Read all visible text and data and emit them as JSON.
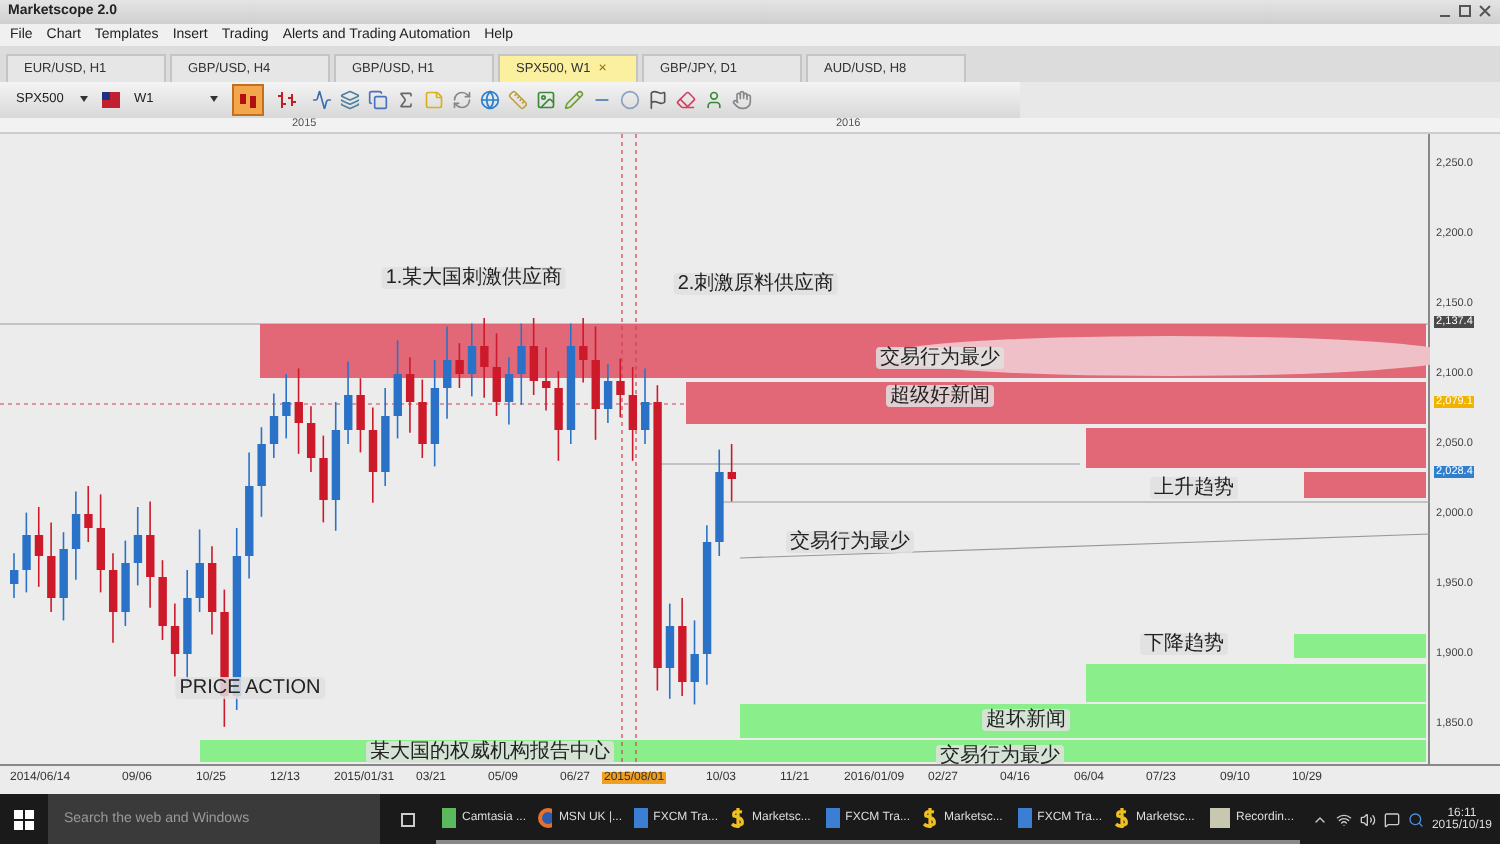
{
  "window": {
    "title": "Marketscope 2.0"
  },
  "menu": [
    "File",
    "Chart",
    "Templates",
    "Insert",
    "Trading",
    "Alerts and Trading Automation",
    "Help"
  ],
  "tabs": [
    {
      "label": "EUR/USD, H1",
      "selected": false
    },
    {
      "label": "GBP/USD, H4",
      "selected": false
    },
    {
      "label": "GBP/USD, H1",
      "selected": false
    },
    {
      "label": "SPX500, W1",
      "selected": true,
      "close": "×"
    },
    {
      "label": "GBP/JPY, D1",
      "selected": false
    },
    {
      "label": "AUD/USD, H8",
      "selected": false
    }
  ],
  "toolbar": {
    "symbol": "SPX500",
    "timeframe": "W1",
    "chart_types": [
      {
        "kind": "candles",
        "selected": true
      },
      {
        "kind": "bars",
        "selected": false
      }
    ]
  },
  "years": [
    "2015",
    "2016"
  ],
  "zones": [
    {
      "kind": "supply",
      "label": "交易行为最少"
    },
    {
      "kind": "supply",
      "label": "超级好新闻"
    },
    {
      "kind": "supply"
    },
    {
      "kind": "supply"
    },
    {
      "kind": "demand"
    },
    {
      "kind": "demand"
    },
    {
      "kind": "demand",
      "label": "超坏新闻"
    },
    {
      "kind": "demand",
      "label": "交易行为最少"
    }
  ],
  "annotations": [
    "1.某大国刺激供应商",
    "2.刺激原料供应商",
    "上升趋势",
    "交易行为最少",
    "下降趋势",
    "PRICE ACTION",
    "某大国的权威机构报告中心"
  ],
  "price_axis": [
    {
      "kind": "tick",
      "label": "2,250.0"
    },
    {
      "kind": "tick",
      "label": "2,200.0"
    },
    {
      "kind": "tick",
      "label": "2,150.0"
    },
    {
      "kind": "marker",
      "label": "2,137.4",
      "color": "#4a4a4a"
    },
    {
      "kind": "tick",
      "label": "2,100.0"
    },
    {
      "kind": "marker",
      "label": "2,079.1",
      "color": "#f0b400"
    },
    {
      "kind": "tick",
      "label": "2,050.0"
    },
    {
      "kind": "marker",
      "label": "2,028.4",
      "color": "#2f7fd0"
    },
    {
      "kind": "tick",
      "label": "2,000.0"
    },
    {
      "kind": "tick",
      "label": "1,950.0"
    },
    {
      "kind": "tick",
      "label": "1,900.0"
    },
    {
      "kind": "tick",
      "label": "1,850.0"
    }
  ],
  "date_axis": [
    {
      "label": "2014/06/14",
      "selected": false
    },
    {
      "label": "09/06",
      "selected": false
    },
    {
      "label": "10/25",
      "selected": false
    },
    {
      "label": "12/13",
      "selected": false
    },
    {
      "label": "2015/01/31",
      "selected": false
    },
    {
      "label": "03/21",
      "selected": false
    },
    {
      "label": "05/09",
      "selected": false
    },
    {
      "label": "06/27",
      "selected": false
    },
    {
      "label": "2015/08/01",
      "selected": true
    },
    {
      "label": "10/03",
      "selected": false
    },
    {
      "label": "11/21",
      "selected": false
    },
    {
      "label": "2016/01/09",
      "selected": false
    },
    {
      "label": "02/27",
      "selected": false
    },
    {
      "label": "04/16",
      "selected": false
    },
    {
      "label": "06/04",
      "selected": false
    },
    {
      "label": "07/23",
      "selected": false
    },
    {
      "label": "09/10",
      "selected": false
    },
    {
      "label": "10/29",
      "selected": false
    }
  ],
  "taskbar": {
    "search": {
      "placeholder": "Search the web and Windows"
    },
    "apps": [
      {
        "kind": "camtasia",
        "label": "Camtasia ..."
      },
      {
        "kind": "browser",
        "label": "MSN UK |..."
      },
      {
        "kind": "fxcm",
        "label": "FXCM Tra..."
      },
      {
        "kind": "marketscope",
        "label": "Marketsc..."
      },
      {
        "kind": "fxcm",
        "label": "FXCM Tra..."
      },
      {
        "kind": "marketscope",
        "label": "Marketsc..."
      },
      {
        "kind": "fxcm",
        "label": "FXCM Tra..."
      },
      {
        "kind": "marketscope",
        "label": "Marketsc..."
      },
      {
        "kind": "recorder",
        "label": "Recordin..."
      }
    ],
    "time": "16:11",
    "date": "2015/10/19"
  }
}
